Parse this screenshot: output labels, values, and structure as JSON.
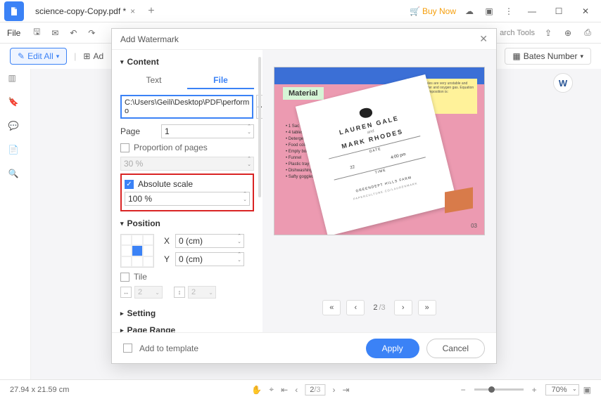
{
  "title_tab": "science-copy-Copy.pdf *",
  "buy_now": "Buy Now",
  "menu": {
    "file": "File"
  },
  "ribbon": {
    "edit_all": "Edit All",
    "add": "Ad",
    "bates": "Bates Number"
  },
  "modal": {
    "title": "Add Watermark",
    "content_section": "Content",
    "tab_text": "Text",
    "tab_file": "File",
    "file_path": "C:\\Users\\Geili\\Desktop\\PDF\\perform o",
    "page_label": "Page",
    "page_value": "1",
    "proportion_label": "Proportion of pages",
    "proportion_value": "30 %",
    "abs_scale_label": "Absolute scale",
    "abs_scale_value": "100 %",
    "position_section": "Position",
    "x_label": "X",
    "x_value": "0 (cm)",
    "y_label": "Y",
    "y_value": "0 (cm)",
    "tile_label": "Tile",
    "tile_h": "2",
    "tile_v": "2",
    "setting_section": "Setting",
    "range_section": "Page Range",
    "add_template": "Add to template",
    "apply": "Apply",
    "cancel": "Cancel",
    "pager_current": "2",
    "pager_total": "/3"
  },
  "preview": {
    "materials": "Material",
    "sticky": "little molecules are very unstable and split into water and oxygen gas. Equation for this decomposition is:",
    "list": [
      "• 1 Sac",
      "• 4 tables.",
      "• Detergent",
      "• Food color",
      "• Empty bottle",
      "• Funnel",
      "• Plastic tray or tub",
      "• Dishwashing gloves",
      "• Safty goggles"
    ],
    "card": {
      "name1": "LAUREN GALE",
      "and": "and",
      "name2": "MARK RHODES",
      "date_lbl": "DATE",
      "time_lbl": "TIME",
      "date": "22",
      "time": "4:00 pm",
      "venue": "GREENDEPT HILLS FARM",
      "foot": "PAPERCULTURE.CO/LAURENMARK"
    },
    "page_num": "03"
  },
  "status": {
    "dims": "27.94 x 21.59 cm",
    "page_current": "2",
    "page_total": "/3",
    "zoom": "70%"
  }
}
